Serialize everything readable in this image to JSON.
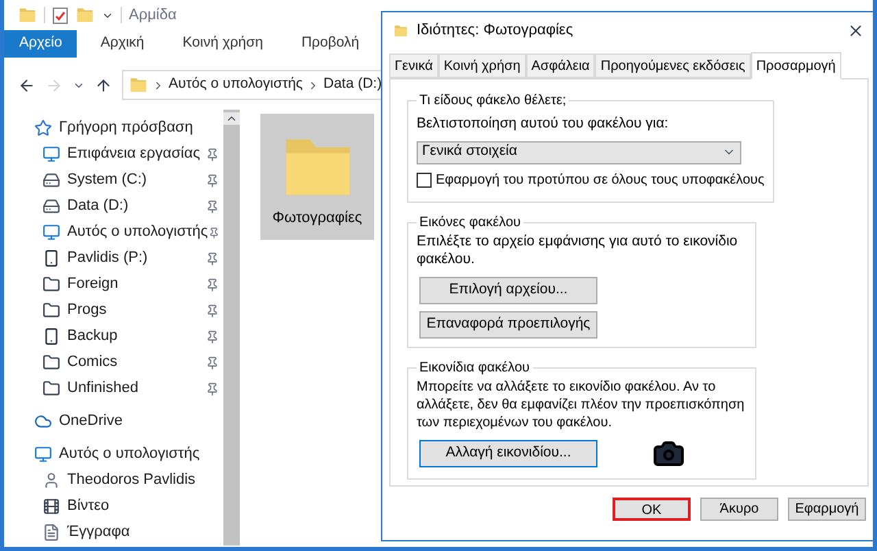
{
  "explorer": {
    "title": "Αρμίδα",
    "ribbon_tabs": [
      {
        "label": "Αρχείο",
        "selected": true
      },
      {
        "label": "Αρχική",
        "selected": false
      },
      {
        "label": "Κοινή χρήση",
        "selected": false
      },
      {
        "label": "Προβολή",
        "selected": false
      }
    ],
    "breadcrumb": [
      "Αυτός ο υπολογιστής",
      "Data (D:)"
    ],
    "nav": [
      {
        "label": "Γρήγορη πρόσβαση",
        "kind": "star",
        "children": [
          {
            "label": "Επιφάνεια εργασίας",
            "kind": "desktop",
            "pinned": true
          },
          {
            "label": "System (C:)",
            "kind": "drive",
            "pinned": true
          },
          {
            "label": "Data (D:)",
            "kind": "drive",
            "pinned": true
          },
          {
            "label": "Αυτός ο υπολογιστής",
            "kind": "computer",
            "pinned": true
          },
          {
            "label": "Pavlidis (P:)",
            "kind": "phone",
            "pinned": true
          },
          {
            "label": "Foreign",
            "kind": "folder",
            "pinned": true
          },
          {
            "label": "Progs",
            "kind": "folder",
            "pinned": true
          },
          {
            "label": "Backup",
            "kind": "phone",
            "pinned": true
          },
          {
            "label": "Comics",
            "kind": "folder",
            "pinned": true
          },
          {
            "label": "Unfinished",
            "kind": "folder",
            "pinned": true
          }
        ]
      },
      {
        "label": "OneDrive",
        "kind": "cloud"
      },
      {
        "label": "Αυτός ο υπολογιστής",
        "kind": "computer",
        "children": [
          {
            "label": "Theodoros Pavlidis",
            "kind": "user"
          },
          {
            "label": "Βίντεο",
            "kind": "video"
          },
          {
            "label": "Έγγραφα",
            "kind": "document"
          }
        ]
      }
    ],
    "files": [
      {
        "label": "Φωτογραφίες",
        "selected": true
      }
    ]
  },
  "dialog": {
    "title": "Ιδιότητες: Φωτογραφίες",
    "tabs": [
      {
        "label": "Γενικά",
        "selected": false
      },
      {
        "label": "Κοινή χρήση",
        "selected": false
      },
      {
        "label": "Ασφάλεια",
        "selected": false
      },
      {
        "label": "Προηγούμενες εκδόσεις",
        "selected": false
      },
      {
        "label": "Προσαρμογή",
        "selected": true
      }
    ],
    "type_group": {
      "legend": "Τι είδους φάκελο θέλετε;",
      "label": "Βελτιστοποίηση αυτού του φακέλου για:",
      "value": "Γενικά στοιχεία",
      "checkbox": {
        "label": "Εφαρμογή του προτύπου σε όλους τους υποφακέλους",
        "checked": false
      }
    },
    "pictures_group": {
      "legend": "Εικόνες φακέλου",
      "text": "Επιλέξτε το αρχείο εμφάνισης για αυτό το εικονίδιο φακέλου.",
      "buttons": [
        {
          "label": "Επιλογή αρχείου...",
          "focused": false
        },
        {
          "label": "Επαναφορά προεπιλογής",
          "focused": false
        }
      ]
    },
    "icons_group": {
      "legend": "Εικονίδια φακέλου",
      "text": "Μπορείτε να αλλάξετε το εικονίδιο φακέλου. Αν το αλλάξετε, δεν θα εμφανίζει πλέον την προεπισκόπηση των περιεχομένων του φακέλου.",
      "buttons": [
        {
          "label": "Αλλαγή εικονιδίου...",
          "focused": true
        }
      ]
    },
    "buttons": [
      {
        "label": "OK",
        "highlighted": true
      },
      {
        "label": "Άκυρο",
        "highlighted": false
      },
      {
        "label": "Εφαρμογή",
        "highlighted": false
      }
    ]
  }
}
